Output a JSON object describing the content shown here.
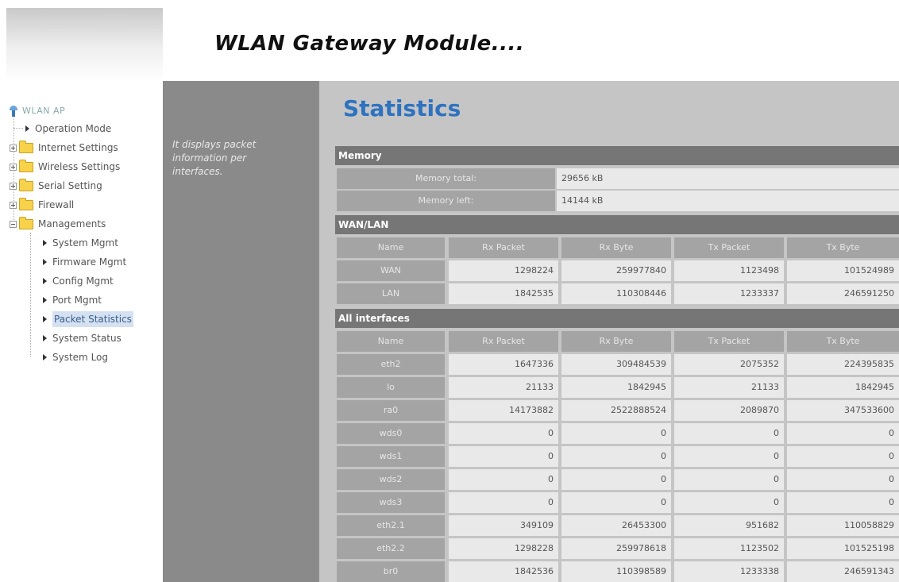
{
  "header": {
    "title": "WLAN Gateway Module...."
  },
  "sidebar": {
    "root": "WLAN AP",
    "items": [
      {
        "label": "Operation Mode",
        "kind": "leaf"
      },
      {
        "label": "Internet Settings",
        "kind": "folder"
      },
      {
        "label": "Wireless Settings",
        "kind": "folder"
      },
      {
        "label": "Serial Setting",
        "kind": "folder"
      },
      {
        "label": "Firewall",
        "kind": "folder"
      },
      {
        "label": "Managements",
        "kind": "folder-open"
      },
      {
        "label": "System Mgmt",
        "kind": "child"
      },
      {
        "label": "Firmware Mgmt",
        "kind": "child"
      },
      {
        "label": "Config Mgmt",
        "kind": "child"
      },
      {
        "label": "Port Mgmt",
        "kind": "child"
      },
      {
        "label": "Packet Statistics",
        "kind": "child-selected"
      },
      {
        "label": "System Status",
        "kind": "child"
      },
      {
        "label": "System Log",
        "kind": "child"
      }
    ]
  },
  "description": "It displays packet information per interfaces.",
  "main": {
    "title": "Statistics",
    "memory": {
      "heading": "Memory",
      "rows": [
        {
          "label": "Memory total:",
          "value": "29656 kB"
        },
        {
          "label": "Memory left:",
          "value": "14144 kB"
        }
      ]
    },
    "wanlan": {
      "heading": "WAN/LAN",
      "columns": [
        "Name",
        "Rx Packet",
        "Rx Byte",
        "Tx Packet",
        "Tx Byte"
      ],
      "rows": [
        [
          "WAN",
          "1298224",
          "259977840",
          "1123498",
          "101524989"
        ],
        [
          "LAN",
          "1842535",
          "110308446",
          "1233337",
          "246591250"
        ]
      ]
    },
    "all": {
      "heading": "All interfaces",
      "columns": [
        "Name",
        "Rx Packet",
        "Rx Byte",
        "Tx Packet",
        "Tx Byte"
      ],
      "rows": [
        [
          "eth2",
          "1647336",
          "309484539",
          "2075352",
          "224395835"
        ],
        [
          "lo",
          "21133",
          "1842945",
          "21133",
          "1842945"
        ],
        [
          "ra0",
          "14173882",
          "2522888524",
          "2089870",
          "347533600"
        ],
        [
          "wds0",
          "0",
          "0",
          "0",
          "0"
        ],
        [
          "wds1",
          "0",
          "0",
          "0",
          "0"
        ],
        [
          "wds2",
          "0",
          "0",
          "0",
          "0"
        ],
        [
          "wds3",
          "0",
          "0",
          "0",
          "0"
        ],
        [
          "eth2.1",
          "349109",
          "26453300",
          "951682",
          "110058829"
        ],
        [
          "eth2.2",
          "1298228",
          "259978618",
          "1123502",
          "101525198"
        ],
        [
          "br0",
          "1842536",
          "110398589",
          "1233338",
          "246591343"
        ]
      ]
    }
  },
  "colors": {
    "title_blue": "#2e72c0",
    "section_header": "#767676",
    "label_cell": "#a4a4a4",
    "value_cell": "#e9e9e9",
    "desc_column": "#8a8a8a",
    "content_bg": "#c5c5c5"
  }
}
